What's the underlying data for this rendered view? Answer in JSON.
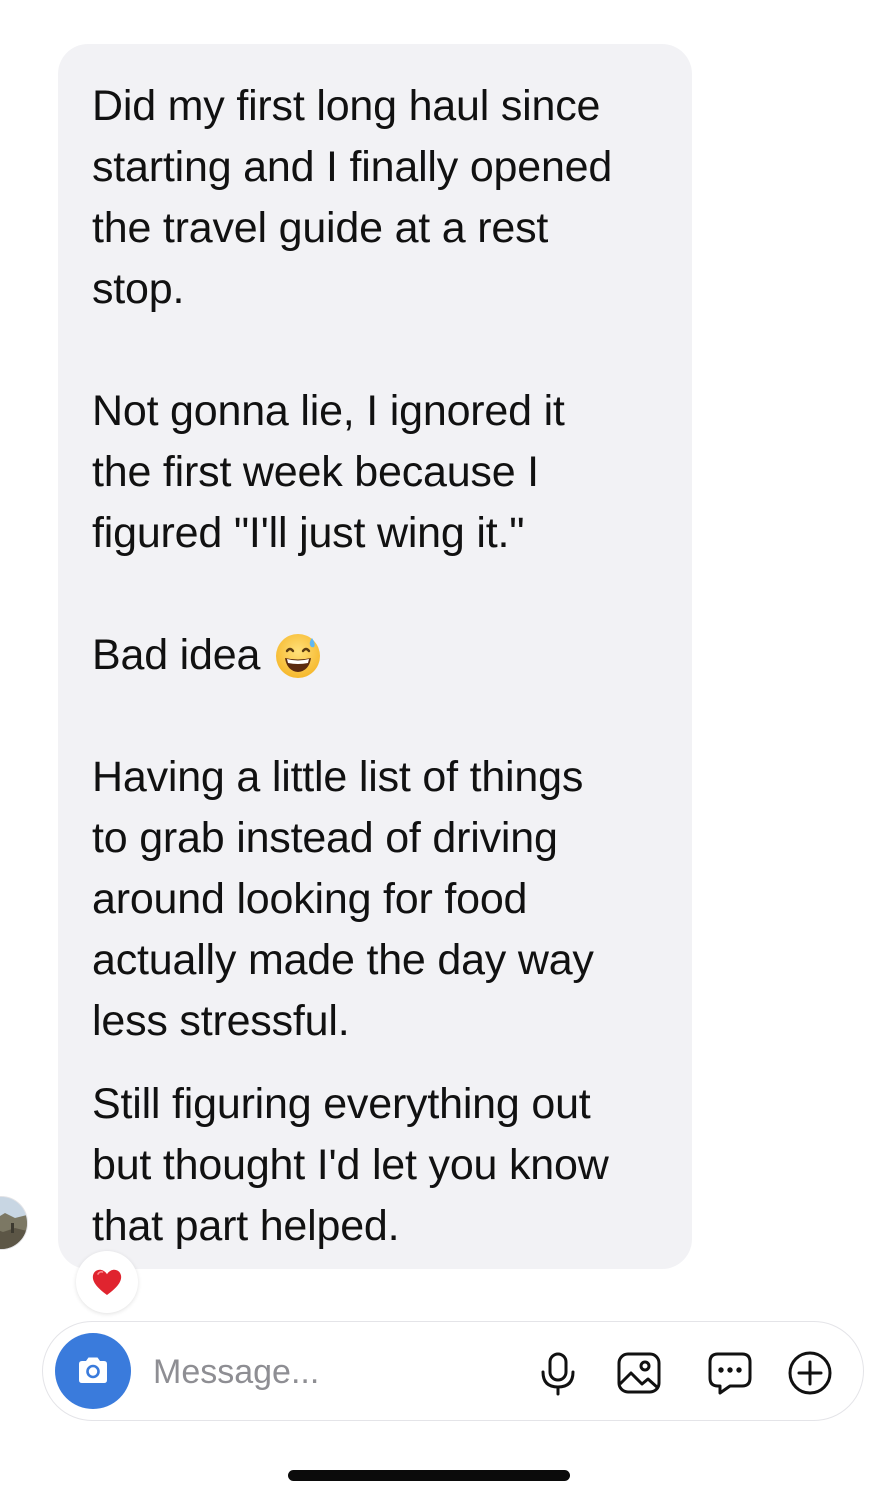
{
  "conversation": {
    "avatar_icon": "contact-avatar",
    "message": {
      "paragraph_1": "Did my first long haul since\nstarting and I finally opened\nthe travel guide at a rest\nstop.",
      "paragraph_2": "Not gonna lie, I ignored it\nthe first week because I\nfigured \"I'll just wing it.\"",
      "paragraph_3_text": "Bad idea",
      "paragraph_3_emoji": "grinning-face-with-sweat-emoji",
      "paragraph_4": "Having a little list of things\nto grab instead of driving\naround looking for food\nactually made the day way\nless stressful.",
      "paragraph_5": "Still figuring everything out\nbut thought I'd let you know\nthat part helped."
    },
    "reaction": {
      "icon": "red-heart-icon",
      "color": "#e0242f"
    }
  },
  "composer": {
    "camera_icon": "camera-icon",
    "camera_color": "#3a7bdc",
    "placeholder": "Message...",
    "icons": [
      "microphone-icon",
      "image-icon",
      "chat-bubble-icon",
      "plus-circle-icon"
    ]
  },
  "colors": {
    "bubble_background": "#f2f2f5",
    "text": "#111111",
    "placeholder": "#8e8e93"
  }
}
